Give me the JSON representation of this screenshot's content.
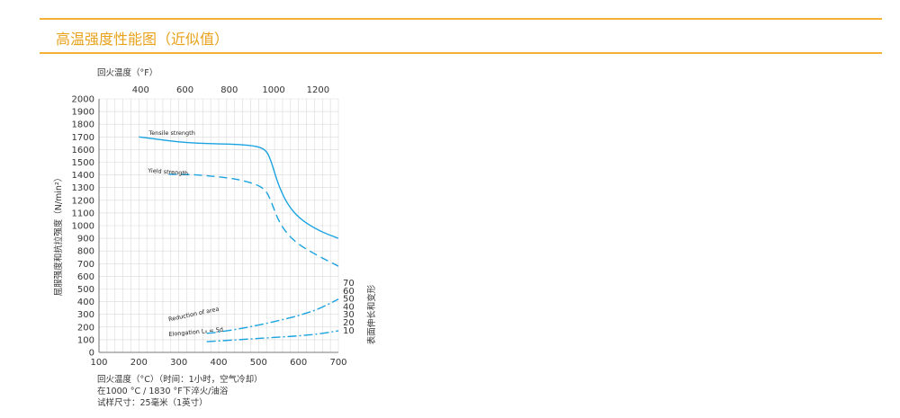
{
  "header": {
    "title": "高温强度性能图（近似值）"
  },
  "colors": {
    "accent": "#f2b035",
    "title": "#e8a21a",
    "curve": "#1aa3e0",
    "grid": "#d9d9d9",
    "text": "#333333"
  },
  "notes": [
    "回火温度（°C）（时间：1小时，空气冷却）",
    "在1000 °C / 1830 °F下淬火/油浴",
    "试样尺寸：25毫米（1英寸）"
  ],
  "chart_data": {
    "type": "line",
    "top_axis": {
      "label": "回火温度（°F）",
      "ticks": [
        400,
        600,
        800,
        1000,
        1200
      ]
    },
    "x_axis": {
      "ticks": [
        100,
        200,
        300,
        400,
        500,
        600,
        700
      ],
      "range": [
        100,
        700
      ]
    },
    "y_left": {
      "label": "屈服强度和抗拉强度（N/min²）",
      "range": [
        0,
        2000
      ],
      "step": 100
    },
    "y_right": {
      "label": "表面伸长和变形",
      "ticks": [
        10,
        20,
        30,
        40,
        50,
        60,
        70
      ]
    },
    "series": [
      {
        "name": "Tensile strength",
        "style": "solid",
        "axis": "left",
        "x": [
          200,
          250,
          300,
          350,
          400,
          450,
          500,
          520,
          530,
          540,
          550,
          570,
          600,
          650,
          700
        ],
        "y": [
          1700,
          1680,
          1660,
          1650,
          1645,
          1642,
          1625,
          1590,
          1520,
          1420,
          1320,
          1180,
          1060,
          960,
          900
        ]
      },
      {
        "name": "Yield strength",
        "style": "dashed",
        "axis": "left",
        "x": [
          275,
          300,
          350,
          400,
          450,
          500,
          520,
          530,
          540,
          550,
          570,
          600,
          650,
          700
        ],
        "y": [
          1405,
          1405,
          1400,
          1385,
          1365,
          1320,
          1270,
          1200,
          1120,
          1040,
          940,
          850,
          760,
          680
        ]
      },
      {
        "name": "Reduction of area",
        "style": "dash-dot",
        "axis": "left",
        "x": [
          370,
          400,
          450,
          500,
          550,
          600,
          650,
          700
        ],
        "y": [
          150,
          160,
          185,
          215,
          250,
          290,
          340,
          420
        ]
      },
      {
        "name": "Elongation L",
        "name_suffix": "₀ = 5d",
        "style": "dash-dot",
        "axis": "left",
        "x": [
          370,
          400,
          450,
          500,
          550,
          600,
          650,
          700
        ],
        "y": [
          85,
          90,
          100,
          110,
          120,
          130,
          145,
          170
        ]
      }
    ]
  }
}
